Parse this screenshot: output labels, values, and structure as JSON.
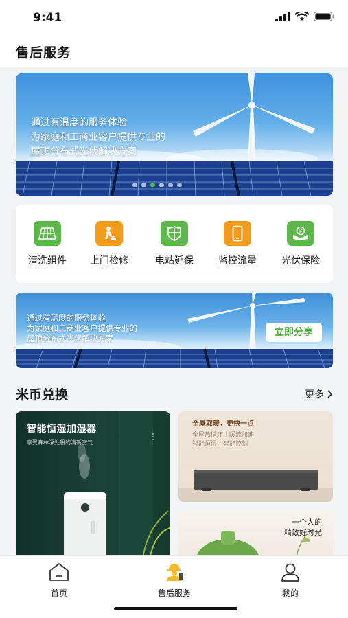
{
  "status_bar": {
    "time": "9:41"
  },
  "header": {
    "title": "售后服务"
  },
  "banner": {
    "lines": [
      "通过有温度的服务体验",
      "为家庭和工商业客户提供专业的",
      "屋顶分布式光伏解决方案"
    ],
    "slide_count": 6,
    "active_slide": 3
  },
  "services": [
    {
      "label": "清洗组件",
      "icon": "solar-panel-icon",
      "color": "#5cb84a"
    },
    {
      "label": "上门检修",
      "icon": "repair-worker-icon",
      "color": "#f39b1a"
    },
    {
      "label": "电站延保",
      "icon": "shield-icon",
      "color": "#5cb84a"
    },
    {
      "label": "监控流量",
      "icon": "smartphone-icon",
      "color": "#f39b1a"
    },
    {
      "label": "光伏保险",
      "icon": "insurance-hands-icon",
      "color": "#5cb84a"
    }
  ],
  "share_banner": {
    "lines": [
      "通过有温度的服务体验",
      "为家庭和工商业客户提供专业的",
      "屋顶分布式光伏解决方案"
    ],
    "button": "立即分享"
  },
  "coin_section": {
    "title": "米币兑换",
    "more": "更多"
  },
  "products": {
    "humidifier": {
      "title": "智能恒湿加湿器",
      "subtitle": "享受森林深处般的清新空气"
    },
    "heater": {
      "title": "全屋取暖，更快一点",
      "sub1": "全屋热循环｜暖流加速",
      "sub2": "智能恒温｜智能控制"
    },
    "vase": {
      "line1": "一个人的",
      "line2": "精致好时光"
    }
  },
  "tabs": [
    {
      "label": "首页",
      "icon": "home-icon",
      "active": false
    },
    {
      "label": "售后服务",
      "icon": "service-worker-icon",
      "active": true
    },
    {
      "label": "我的",
      "icon": "user-icon",
      "active": false
    }
  ],
  "colors": {
    "brand_green": "#4cb848",
    "accent_orange": "#f39b1a",
    "active_tab": "#f5b82a"
  }
}
